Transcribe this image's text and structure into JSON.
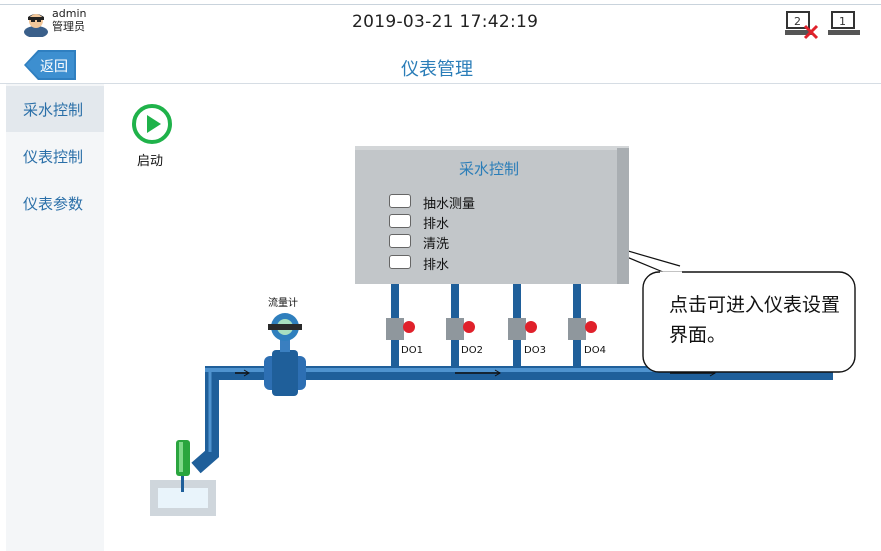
{
  "header": {
    "user_name": "admin",
    "user_role": "管理员",
    "datetime": "2019-03-21 17:42:19",
    "back_label": "返回",
    "page_title": "仪表管理",
    "network": [
      {
        "icon": "network-computer-2-disconnected-icon",
        "label": "2"
      },
      {
        "icon": "network-computer-1-icon",
        "label": "1"
      }
    ]
  },
  "sidebar": {
    "items": [
      {
        "label": "采水控制",
        "active": true
      },
      {
        "label": "仪表控制",
        "active": false
      },
      {
        "label": "仪表参数",
        "active": false
      }
    ]
  },
  "main": {
    "start_label": "启动",
    "panel": {
      "title": "采水控制",
      "options": [
        {
          "label": "抽水测量"
        },
        {
          "label": "排水"
        },
        {
          "label": "清洗"
        },
        {
          "label": "排水"
        }
      ]
    },
    "flowmeter_label": "流量计",
    "valves": [
      "DO1",
      "DO2",
      "DO3",
      "DO4"
    ],
    "callout": "点击可进入仪表设置界面。"
  },
  "colors": {
    "accent": "#2a7db8",
    "pipe": "#1f5f9a",
    "start_green": "#1fb24a",
    "valve_red": "#e0212b",
    "panel_grey": "#c2c6c9"
  }
}
